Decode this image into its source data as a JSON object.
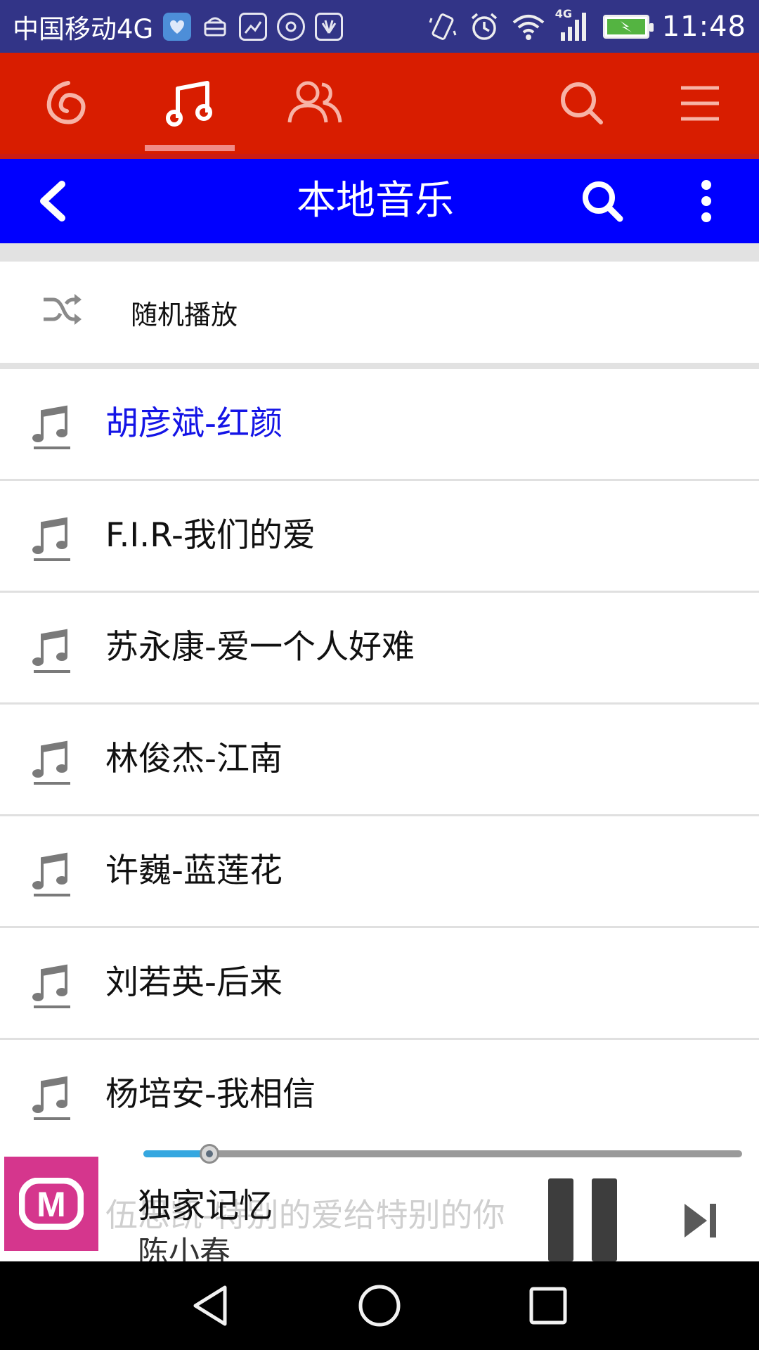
{
  "status_bar": {
    "carrier": "中国移动4G",
    "network_badge": "4G",
    "time": "11:48",
    "icons": [
      "health-icon",
      "android-debug-icon",
      "image-icon",
      "app-icon",
      "huawei-icon",
      "vibrate-icon",
      "alarm-icon",
      "wifi-icon",
      "signal-icon",
      "battery-charging-icon"
    ]
  },
  "app_header": {
    "tabs": [
      {
        "name": "discover",
        "icon": "netease-logo-icon"
      },
      {
        "name": "music",
        "icon": "music-note-icon",
        "active": true
      },
      {
        "name": "friends",
        "icon": "friends-icon"
      }
    ],
    "actions": [
      {
        "name": "search",
        "icon": "search-icon"
      },
      {
        "name": "menu",
        "icon": "menu-icon"
      }
    ]
  },
  "title_bar": {
    "title": "本地音乐",
    "back_icon": "back-arrow-icon",
    "search_icon": "search-icon",
    "more_icon": "more-vertical-icon"
  },
  "shuffle": {
    "label": "随机播放",
    "icon": "shuffle-icon"
  },
  "songs": [
    {
      "name": "胡彦斌-红颜",
      "current": true
    },
    {
      "name": "F.I.R-我们的爱"
    },
    {
      "name": "苏永康-爱一个人好难"
    },
    {
      "name": "林俊杰-江南"
    },
    {
      "name": "许巍-蓝莲花"
    },
    {
      "name": "刘若英-后来"
    },
    {
      "name": "杨培安-我相信"
    }
  ],
  "ghost_song": "伍思凯-特别的爱给特别的你",
  "now_playing": {
    "title": "独家记忆",
    "artist": "陈小春",
    "progress": 0.11,
    "album_logo": "M"
  },
  "colors": {
    "status_bar": "#323487",
    "header": "#d81d00",
    "title_bar": "#0000ff",
    "current_song": "#1414e6",
    "progress": "#35a7e0",
    "album_art": "#d5368d"
  },
  "nav_bar": {
    "buttons": [
      "back-triangle-icon",
      "home-circle-icon",
      "recents-square-icon"
    ]
  }
}
